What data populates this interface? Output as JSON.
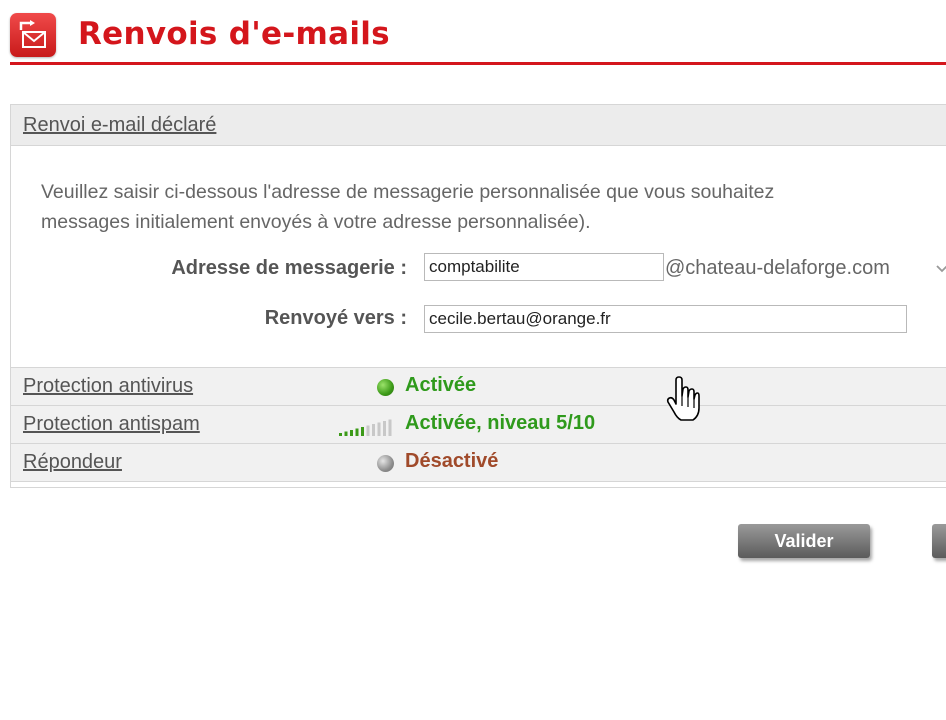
{
  "header": {
    "title": "Renvois d'e-mails",
    "accent_color": "#d4161c",
    "icon": "mail-forward-icon"
  },
  "section": {
    "title": "Renvoi e-mail déclaré",
    "description_line1": "Veuillez saisir ci-dessous l'adresse de messagerie personnalisée que vous souhaitez",
    "description_line2": "messages initialement envoyés à votre adresse personnalisée)."
  },
  "form": {
    "address_label": "Adresse de messagerie :",
    "address_value": "comptabilite",
    "domain_suffix": "@chateau-delaforge.com",
    "forward_label": "Renvoyé vers :",
    "forward_value": "cecile.bertau@orange.fr"
  },
  "status": [
    {
      "label": "Protection antivirus",
      "state": "Activée",
      "indicator": "green-dot",
      "color": "#2f9a1c"
    },
    {
      "label": "Protection antispam",
      "state": "Activée, niveau 5/10",
      "indicator": "level-bars",
      "level": 5,
      "level_max": 10,
      "color": "#2f9a1c"
    },
    {
      "label": "Répondeur",
      "state": "Désactivé",
      "indicator": "grey-dot",
      "color": "#a04a2a"
    }
  ],
  "buttons": {
    "validate": "Valider"
  }
}
